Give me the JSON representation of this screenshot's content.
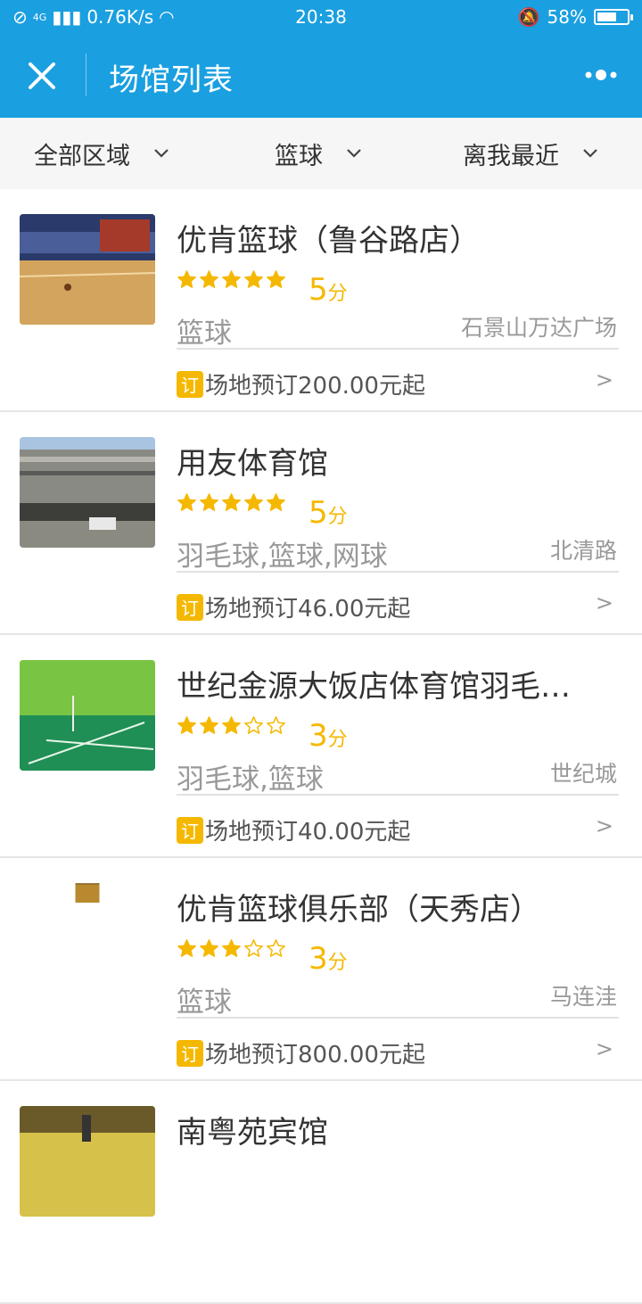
{
  "status_bar": {
    "network": "4G",
    "speed": "0.76K/s",
    "time": "20:38",
    "battery": "58%",
    "battery_level": 0.58
  },
  "nav": {
    "title": "场馆列表"
  },
  "filters": {
    "area": "全部区域",
    "sport": "篮球",
    "sort": "离我最近"
  },
  "venues": [
    {
      "name": "优肯篮球（鲁谷路店）",
      "rating": 5,
      "score": "5",
      "unit": "分",
      "sports": "篮球",
      "location": "石景山万达广场",
      "badge": "订",
      "price": "场地预订200.00元起",
      "arrow": ">"
    },
    {
      "name": "用友体育馆",
      "rating": 5,
      "score": "5",
      "unit": "分",
      "sports": "羽毛球,篮球,网球",
      "location": "北清路",
      "badge": "订",
      "price": "场地预订46.00元起",
      "arrow": ">"
    },
    {
      "name": "世纪金源大饭店体育馆羽毛…",
      "rating": 3,
      "score": "3",
      "unit": "分",
      "sports": "羽毛球,篮球",
      "location": "世纪城",
      "badge": "订",
      "price": "场地预订40.00元起",
      "arrow": ">"
    },
    {
      "name": "优肯篮球俱乐部（天秀店）",
      "rating": 3,
      "score": "3",
      "unit": "分",
      "sports": "篮球",
      "location": "马连洼",
      "badge": "订",
      "price": "场地预订800.00元起",
      "arrow": ">"
    },
    {
      "name": "南粤苑宾馆",
      "rating": 0,
      "score": "",
      "unit": "",
      "sports": "",
      "location": "",
      "badge": "",
      "price": "",
      "arrow": ""
    }
  ],
  "colors": {
    "brand": "#1a9fe0",
    "star": "#f5b800"
  }
}
